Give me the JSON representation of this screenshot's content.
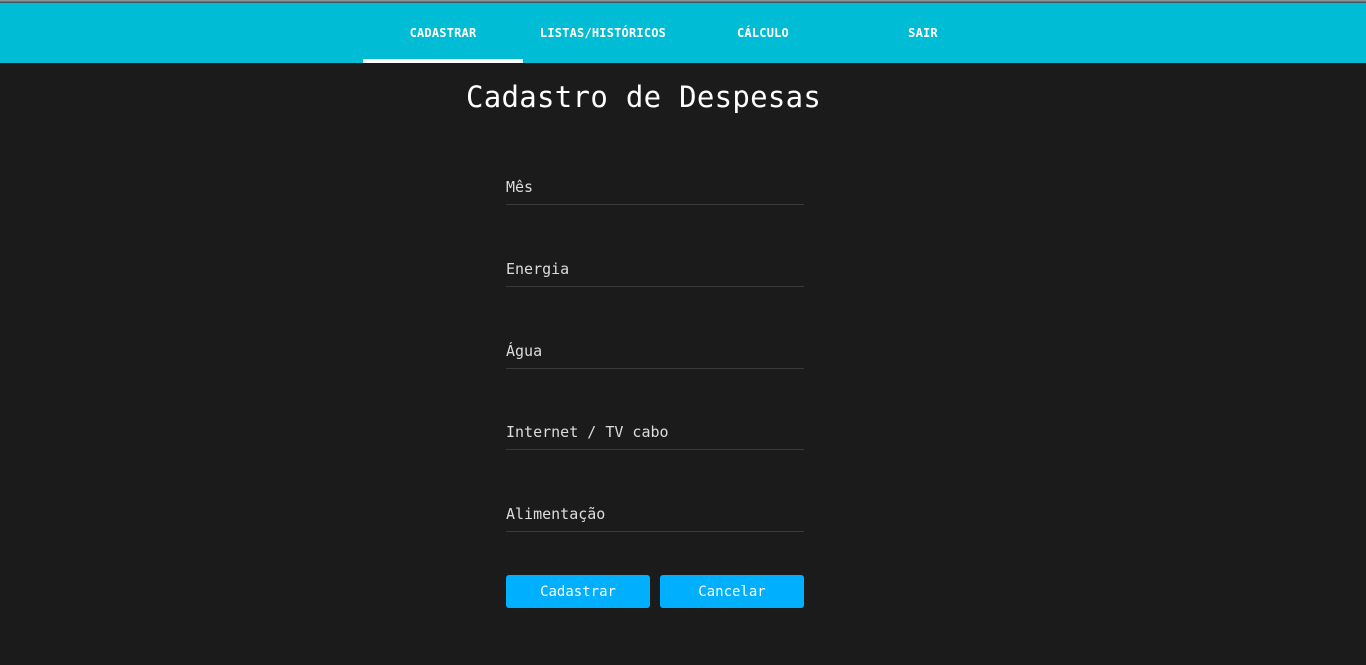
{
  "nav": {
    "items": [
      {
        "label": "CADASTRAR",
        "active": true
      },
      {
        "label": "LISTAS/HISTÓRICOS",
        "active": false
      },
      {
        "label": "CÁLCULO",
        "active": false
      },
      {
        "label": "SAIR",
        "active": false
      }
    ]
  },
  "page": {
    "title": "Cadastro de Despesas"
  },
  "form": {
    "fields": [
      {
        "placeholder": "Mês",
        "value": ""
      },
      {
        "placeholder": "Energia",
        "value": ""
      },
      {
        "placeholder": "Água",
        "value": ""
      },
      {
        "placeholder": "Internet / TV cabo",
        "value": ""
      },
      {
        "placeholder": "Alimentação",
        "value": ""
      }
    ],
    "submit_label": "Cadastrar",
    "cancel_label": "Cancelar"
  },
  "colors": {
    "navbar": "#00bcd4",
    "background": "#1b1b1b",
    "button": "#00b0ff"
  }
}
